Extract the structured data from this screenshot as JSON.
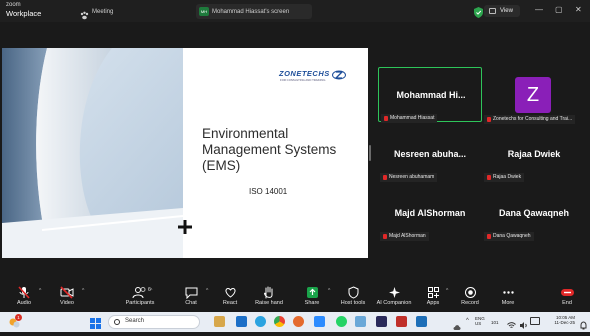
{
  "titlebar": {
    "brand_line1": "zoom",
    "brand_line2": "Workplace",
    "tabs": [
      {
        "label": "Meeting"
      },
      {
        "label": "Mohammad Hiassat's screen",
        "badge": "MH"
      }
    ],
    "view_label": "View",
    "colors": {
      "accent": "#2da44e"
    }
  },
  "shared_screen": {
    "slide_title": "Environmental Management Systems (EMS)",
    "slide_subtitle": "ISO 14001",
    "logo_text": "ZONETECHS",
    "logo_tagline": "FOR CONSULTING AND TRAINING"
  },
  "gallery": {
    "tiles": [
      {
        "name": "Mohammad  Hi...",
        "label": "Mohammad Hiassat",
        "active": true
      },
      {
        "name": "",
        "avatar_letter": "Z",
        "label": "Zonetechs for Consulting and Trai..."
      },
      {
        "name": "Nesreen  abuha...",
        "label": "Nesreen abuhamam"
      },
      {
        "name": "Rajaa Dwiek",
        "label": "Rajaa Dwiek"
      },
      {
        "name": "Majd AlShorman",
        "label": "Majd AlShorman"
      },
      {
        "name": "Dana Qawaqneh",
        "label": "Dana Qawaqneh"
      }
    ],
    "avatar_color": "#8a1fb8"
  },
  "toolbar": {
    "audio": "Audio",
    "video": "Video",
    "participants": "Participants",
    "participants_count": "6",
    "chat": "Chat",
    "react": "React",
    "raise_hand": "Raise hand",
    "share": "Share",
    "host_tools": "Host tools",
    "ai_companion": "AI Companion",
    "apps": "Apps",
    "record": "Record",
    "more": "More",
    "end": "End",
    "colors": {
      "end": "#e02828",
      "share": "#1aa34a",
      "muted": "#e02828"
    }
  },
  "taskbar": {
    "search_placeholder": "Search",
    "notification_count": "1",
    "lang_line1": "ENG",
    "lang_line2": "US",
    "time": "10:05 AM",
    "date": "11-Dec-25",
    "tray_count": "101"
  }
}
